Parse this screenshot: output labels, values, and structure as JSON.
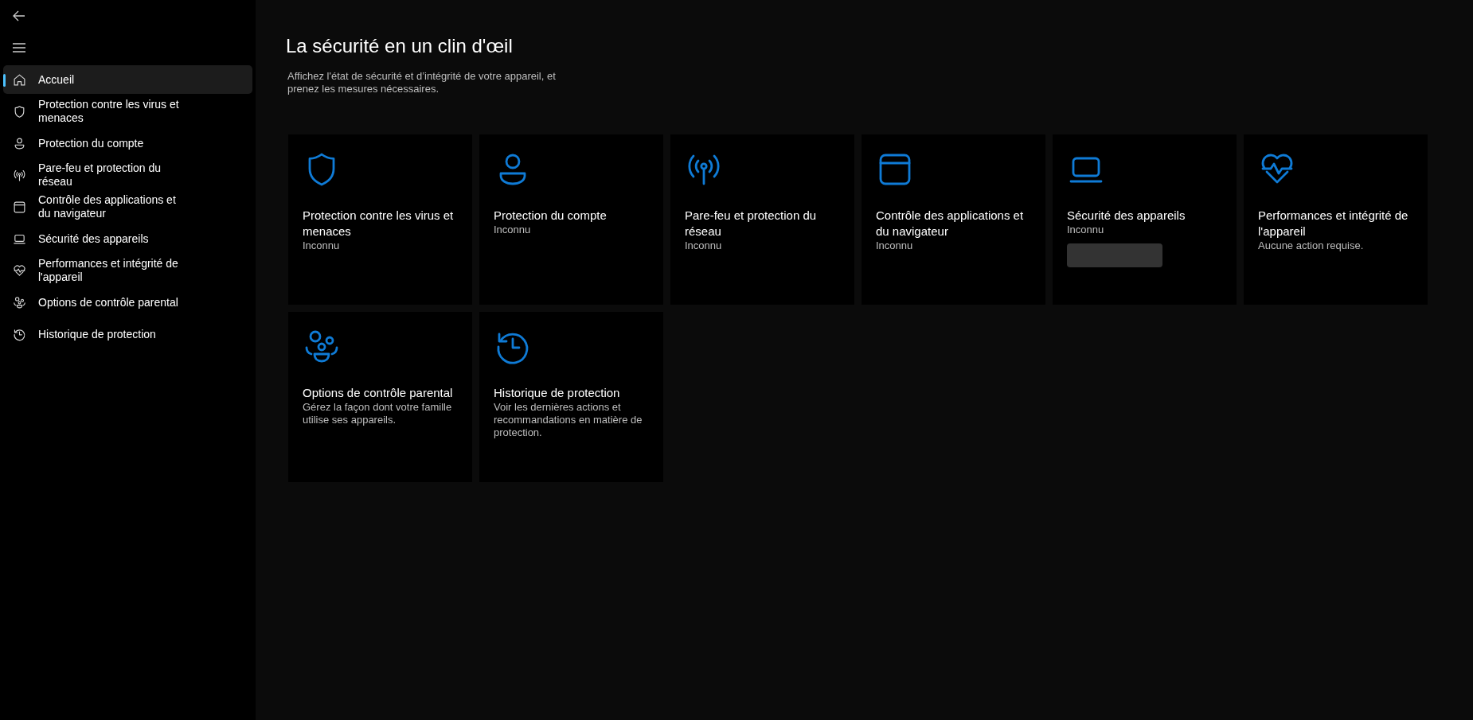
{
  "sidebar": {
    "items": [
      {
        "label": "Accueil",
        "selected": true
      },
      {
        "label": "Protection contre les virus et menaces",
        "selected": false
      },
      {
        "label": "Protection du compte",
        "selected": false
      },
      {
        "label": "Pare-feu et protection du réseau",
        "selected": false
      },
      {
        "label": "Contrôle des applications et du navigateur",
        "selected": false
      },
      {
        "label": "Sécurité des appareils",
        "selected": false
      },
      {
        "label": "Performances et intégrité de l'appareil",
        "selected": false
      },
      {
        "label": "Options de contrôle parental",
        "selected": false
      },
      {
        "label": "Historique de protection",
        "selected": false
      }
    ]
  },
  "page": {
    "title": "La sécurité en un clin d'œil",
    "subtitle": "Affichez l'état de sécurité et d’intégrité de votre appareil, et prenez les mesures nécessaires."
  },
  "cards": [
    {
      "title": "Protection contre les virus et menaces",
      "status": "Inconnu",
      "action_button": false
    },
    {
      "title": "Protection du compte",
      "status": "Inconnu",
      "action_button": false
    },
    {
      "title": "Pare-feu et protection du réseau",
      "status": "Inconnu",
      "action_button": false
    },
    {
      "title": "Contrôle des applications et du navigateur",
      "status": "Inconnu",
      "action_button": false
    },
    {
      "title": "Sécurité des appareils",
      "status": "Inconnu",
      "action_button": true
    },
    {
      "title": "Performances et intégrité de l'appareil",
      "status": "Aucune action requise.",
      "action_button": false
    },
    {
      "title": "Options de contrôle parental",
      "status": "Gérez la façon dont votre famille utilise ses appareils.",
      "action_button": false
    },
    {
      "title": "Historique de protection",
      "status": "Voir les dernières actions et recommandations en matière de protection.",
      "action_button": false
    }
  ]
}
